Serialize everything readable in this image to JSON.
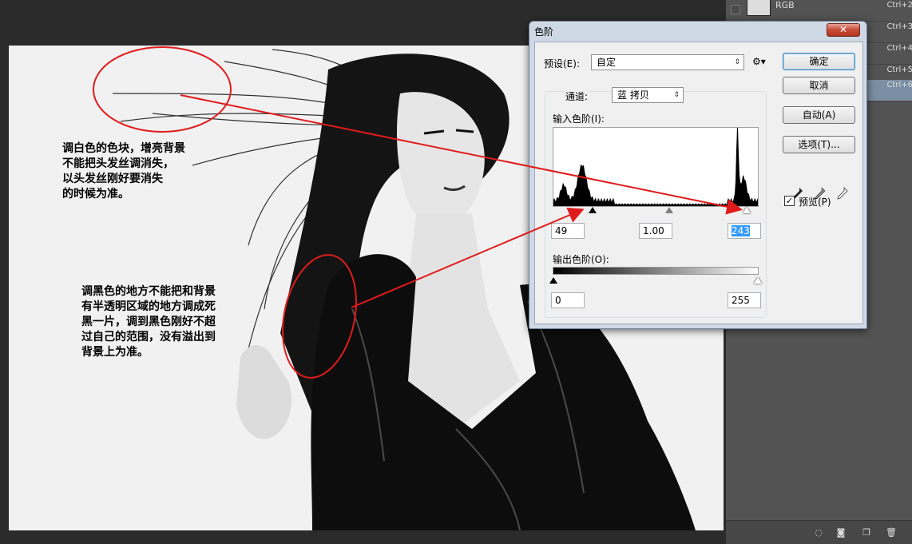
{
  "dialog": {
    "title": "色阶",
    "close_glyph": "✕",
    "preset_label": "预设(E):",
    "preset_value": "自定",
    "channel_label": "通道:",
    "channel_value": "蓝 拷贝",
    "input_levels_label": "输入色阶(I):",
    "input_black": "49",
    "input_gray": "1.00",
    "input_white": "243",
    "output_levels_label": "输出色阶(O):",
    "output_black": "0",
    "output_white": "255",
    "buttons": {
      "ok": "确定",
      "cancel": "取消",
      "auto": "自动(A)",
      "options": "选项(T)..."
    },
    "preview_label": "预览(P)",
    "preview_checked": "✓"
  },
  "channels": [
    {
      "name": "RGB",
      "shortcut": "Ctrl+2"
    },
    {
      "name": "",
      "shortcut": "Ctrl+3"
    },
    {
      "name": "",
      "shortcut": "Ctrl+4"
    },
    {
      "name": "",
      "shortcut": "Ctrl+5"
    },
    {
      "name": "",
      "shortcut": "Ctrl+6",
      "selected": true
    }
  ],
  "annotations": {
    "white_note": [
      "调白色的色块，增亮背景",
      "不能把头发丝调消失，",
      "以头发丝刚好要消失",
      "的时候为准。"
    ],
    "black_note": [
      "调黑色的地方不能把和背景",
      "有半透明区域的地方调成死",
      "黑一片，调到黑色刚好不超",
      "过自己的范围，没有溢出到",
      "背景上为准。"
    ]
  },
  "colors": {
    "annotation_red": "#e01b1b",
    "selection_blue": "#3399ff",
    "panel_gray": "#535353"
  },
  "histogram": {
    "peaks": [
      [
        0.14,
        0.45
      ],
      [
        0.9,
        1.0
      ]
    ]
  }
}
